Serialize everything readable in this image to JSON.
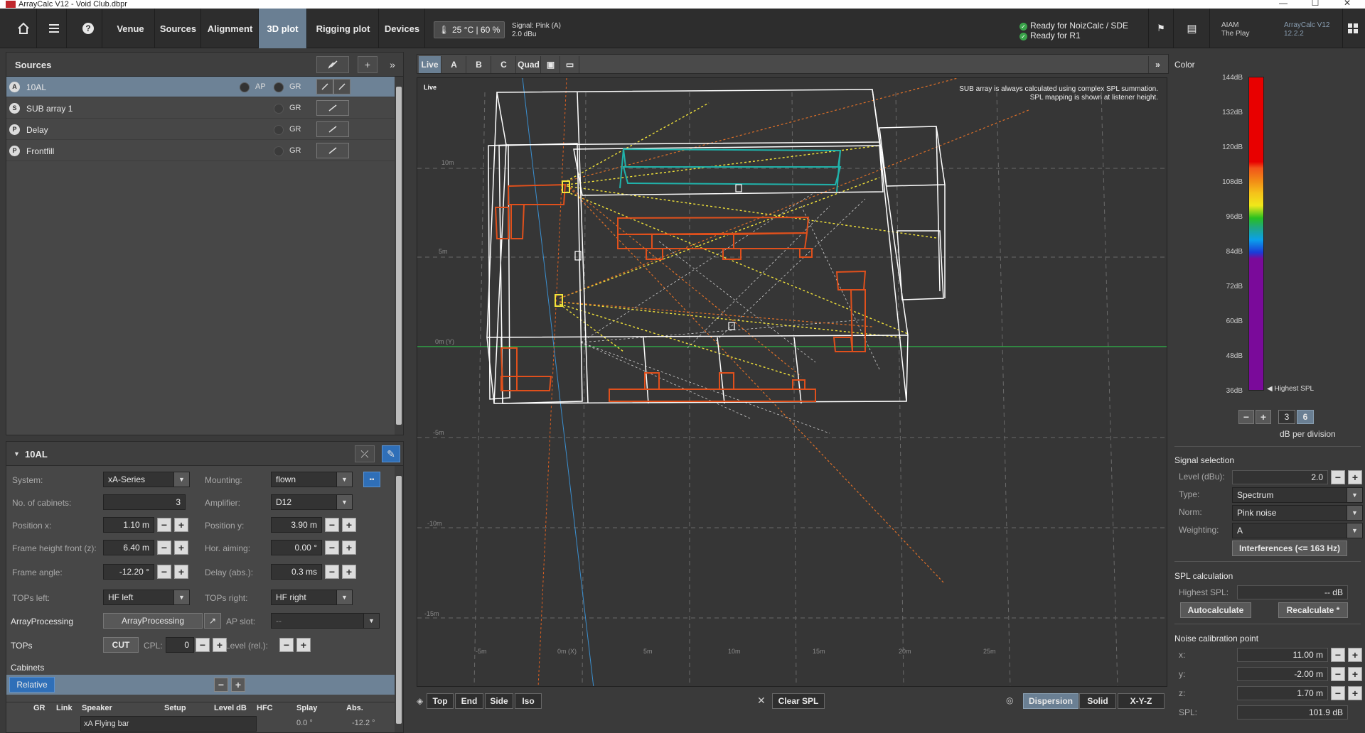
{
  "window": {
    "title": "ArrayCalc V12 - Void Club.dbpr",
    "min": "—",
    "max": "☐",
    "close": "✕"
  },
  "toolbar": {
    "home_icon": "home-icon",
    "menu_icon": "hamburger-menu-icon",
    "help_icon": "help-icon",
    "tabs": [
      "Venue",
      "Sources",
      "Alignment",
      "3D plot",
      "Rigging plot",
      "Devices"
    ],
    "active_tab": "3D plot",
    "temperature": "25 °C | 60 %",
    "signal_line1": "Signal: Pink (A)",
    "signal_line2": "2.0 dBu",
    "ready1": "Ready for NoizCalc / SDE",
    "ready2": "Ready for R1",
    "user_line1": "AIAM",
    "user_line2": "The Play",
    "version_line1": "ArrayCalc V12",
    "version_line2": "12.2.2"
  },
  "sources": {
    "title": "Sources",
    "items": [
      {
        "badge": "A",
        "name": "10AL",
        "ap": "AP",
        "gr": "GR"
      },
      {
        "badge": "S",
        "name": "SUB array 1",
        "gr": "GR"
      },
      {
        "badge": "P",
        "name": "Delay",
        "gr": "GR"
      },
      {
        "badge": "P",
        "name": "Frontfill",
        "gr": "GR"
      }
    ]
  },
  "props": {
    "title": "10AL",
    "system_label": "System:",
    "system_value": "xA-Series",
    "mounting_label": "Mounting:",
    "mounting_value": "flown",
    "cabinets_label": "No. of cabinets:",
    "cabinets_value": "3",
    "amplifier_label": "Amplifier:",
    "amplifier_value": "D12",
    "posx_label": "Position x:",
    "posx_value": "1.10 m",
    "posy_label": "Position y:",
    "posy_value": "3.90 m",
    "frameh_label": "Frame height front (z):",
    "frameh_value": "6.40 m",
    "horaim_label": "Hor. aiming:",
    "horaim_value": "0.00 °",
    "frameangle_label": "Frame angle:",
    "frameangle_value": "-12.20 °",
    "delay_label": "Delay (abs.):",
    "delay_value": "0.3 ms",
    "topsleft_label": "TOPs left:",
    "topsleft_value": "HF left",
    "topsright_label": "TOPs right:",
    "topsright_value": "HF right",
    "arrayproc_label": "ArrayProcessing",
    "arrayproc_btn": "ArrayProcessing",
    "apslot_label": "AP slot:",
    "apslot_value": "--",
    "tops_label": "TOPs",
    "cut_btn": "CUT",
    "cpl_label": "CPL:",
    "cpl_value": "0",
    "levelrel_label": "Level (rel.):",
    "cabinets_section": "Cabinets",
    "relative_btn": "Relative",
    "table_headers": [
      "GR",
      "Link",
      "Speaker",
      "Setup",
      "Level dB",
      "HFC",
      "Splay",
      "Abs."
    ],
    "table_row1": [
      "xA Flying bar",
      "0.0 °",
      "-12.2 °"
    ]
  },
  "view": {
    "tabs": [
      "Live",
      "A",
      "B",
      "C",
      "Quad"
    ],
    "active_tab": "Live",
    "live_label": "Live",
    "note1": "SUB array is always calculated using complex SPL summation.",
    "note2": "SPL mapping is shown at listener height.",
    "y_ticks": [
      "10m",
      "5m",
      "0m (Y)",
      "-5m",
      "-10m",
      "-15m"
    ],
    "x_ticks": [
      "-5m",
      "0m (X)",
      "5m",
      "10m",
      "15m",
      "20m",
      "25m"
    ],
    "bottom_views": [
      "Top",
      "End",
      "Side",
      "Iso"
    ],
    "clear_spl": "Clear SPL",
    "display_modes": [
      "Dispersion",
      "Solid",
      "X-Y-Z"
    ],
    "active_mode": "Dispersion"
  },
  "color": {
    "title": "Color",
    "db_labels": [
      "144dB",
      "132dB",
      "120dB",
      "108dB",
      "96dB",
      "84dB",
      "72dB",
      "60dB",
      "48dB",
      "36dB"
    ],
    "highest_marker": "Highest SPL",
    "div_options": [
      "3",
      "6"
    ],
    "div_active": "6",
    "div_label": "dB per division"
  },
  "signal": {
    "title": "Signal selection",
    "level_label": "Level (dBu):",
    "level_value": "2.0",
    "type_label": "Type:",
    "type_value": "Spectrum",
    "norm_label": "Norm:",
    "norm_value": "Pink noise",
    "weighting_label": "Weighting:",
    "weighting_value": "A",
    "interferences_btn": "Interferences (<= 163 Hz)"
  },
  "spl": {
    "title": "SPL calculation",
    "highest_label": "Highest SPL:",
    "highest_value": "-- dB",
    "autocalc_btn": "Autocalculate",
    "recalc_btn": "Recalculate *"
  },
  "noise": {
    "title": "Noise calibration point",
    "x_label": "x:",
    "x_value": "11.00 m",
    "y_label": "y:",
    "y_value": "-2.00 m",
    "z_label": "z:",
    "z_value": "1.70 m",
    "spl_label": "SPL:",
    "spl_value": "101.9 dB"
  },
  "colors": {
    "accent": "#6a7f93",
    "panel": "#474747",
    "room_lines": "#ffffff",
    "furniture": "#e0501c",
    "bar": "#20b2aa",
    "rays": "#f2e33a"
  }
}
